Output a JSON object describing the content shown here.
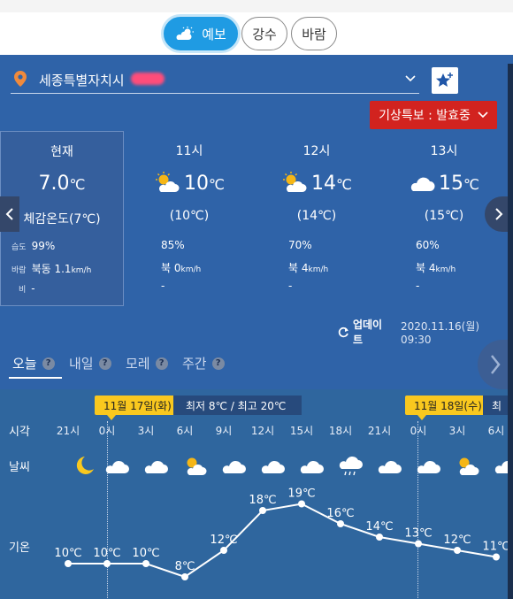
{
  "tabs": [
    {
      "label": "예보",
      "icon": "sun-cloud-icon",
      "active": true
    },
    {
      "label": "강수",
      "active": false
    },
    {
      "label": "바람",
      "active": false
    }
  ],
  "location": {
    "name": "세종특별자치시"
  },
  "alert": {
    "label": "기상특보 : 발효중"
  },
  "now": {
    "title": "현재",
    "temp": "7.0",
    "unit": "℃",
    "feel": "체감온도(7℃)",
    "humidity_label": "습도",
    "humidity": "99%",
    "wind_label": "바람",
    "wind_dir": "북동",
    "wind_speed": "1.1",
    "wind_unit": "km/h",
    "rain_label": "비",
    "rain": "-"
  },
  "hours": [
    {
      "time": "11시",
      "temp": "10",
      "icon": "sun-cloud-icon",
      "feel": "(10℃)",
      "humidity": "85%",
      "wind_dir": "북",
      "wind_speed": "0",
      "rain": "-"
    },
    {
      "time": "12시",
      "temp": "14",
      "icon": "sun-cloud-icon",
      "feel": "(14℃)",
      "humidity": "70%",
      "wind_dir": "북",
      "wind_speed": "4",
      "rain": "-"
    },
    {
      "time": "13시",
      "temp": "15",
      "icon": "cloud-icon",
      "feel": "(15℃)",
      "humidity": "60%",
      "wind_dir": "북",
      "wind_speed": "4",
      "rain": "-"
    }
  ],
  "unit": "℃",
  "wind_unit": "km/h",
  "update": {
    "label": "업데이트",
    "time": "2020.11.16(월) 09:30"
  },
  "day_tabs": [
    {
      "label": "오늘",
      "active": true
    },
    {
      "label": "내일",
      "active": false
    },
    {
      "label": "모레",
      "active": false
    },
    {
      "label": "주간",
      "active": false
    }
  ],
  "help_glyph": "?",
  "timeline": {
    "date1": "11월 17일(화)",
    "minmax": "최저 8℃ / 최고 20℃",
    "date2": "11월 18일(수)",
    "minmax2_partial": "최",
    "row_time": "시각",
    "row_weather": "날씨",
    "row_temp": "기온",
    "hours": [
      "21시",
      "0시",
      "3시",
      "6시",
      "9시",
      "12시",
      "15시",
      "18시",
      "21시",
      "0시",
      "3시",
      "6시"
    ],
    "icons": [
      "moon-icon",
      "cloud-icon",
      "cloud-icon",
      "sun-cloud-icon",
      "cloud-icon",
      "cloud-icon",
      "cloud-icon",
      "rain-icon",
      "cloud-icon",
      "cloud-icon",
      "sun-cloud-icon",
      "cloud-icon"
    ]
  },
  "chart_data": {
    "type": "line",
    "x": [
      "21시",
      "0시",
      "3시",
      "6시",
      "9시",
      "12시",
      "15시",
      "18시",
      "21시",
      "0시",
      "3시",
      "6시"
    ],
    "values": [
      10,
      10,
      10,
      8,
      12,
      18,
      19,
      16,
      14,
      13,
      12,
      11
    ],
    "labels": [
      "10℃",
      "10℃",
      "10℃",
      "8℃",
      "12℃",
      "18℃",
      "19℃",
      "16℃",
      "14℃",
      "13℃",
      "12℃",
      "11℃"
    ],
    "ylabel": "기온"
  },
  "colors": {
    "accent": "#1f9be3",
    "alert": "#d2231f",
    "date_pill": "#f9c81e",
    "moon": "#f9c81e",
    "sun": "#f5b616"
  }
}
